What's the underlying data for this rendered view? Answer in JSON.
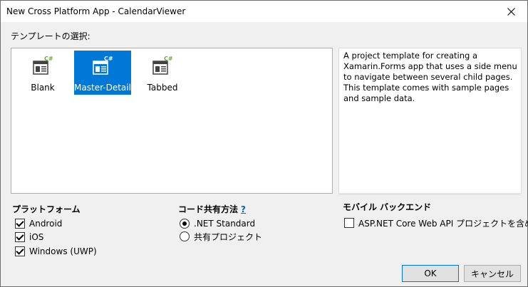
{
  "window": {
    "title": "New Cross Platform App - CalendarViewer"
  },
  "templates": {
    "heading": "テンプレートの選択:",
    "items": [
      {
        "label": "Blank",
        "icon": "csharp-template-icon",
        "selected": false
      },
      {
        "label": "Master-Detail",
        "icon": "csharp-template-icon",
        "selected": true
      },
      {
        "label": "Tabbed",
        "icon": "csharp-template-icon",
        "selected": false
      }
    ],
    "description": "A project template for creating a Xamarin.Forms app that uses a side menu to navigate between several child pages. This template comes with sample pages and sample data."
  },
  "platform": {
    "heading": "プラットフォーム",
    "options": [
      {
        "label": "Android",
        "checked": true
      },
      {
        "label": "iOS",
        "checked": true
      },
      {
        "label": "Windows (UWP)",
        "checked": true
      }
    ]
  },
  "code_sharing": {
    "heading": "コード共有方法",
    "help": "?",
    "options": [
      {
        "label": ".NET Standard",
        "selected": true
      },
      {
        "label": "共有プロジェクト",
        "selected": false
      }
    ]
  },
  "mobile_backend": {
    "heading": "モバイル バックエンド",
    "option": {
      "label": "ASP.NET Core Web API プロジェクトを含める",
      "checked": false
    }
  },
  "buttons": {
    "ok": "OK",
    "cancel": "キャンセル"
  },
  "colors": {
    "selection": "#0078d7",
    "link": "#0066cc",
    "csharp_badge": "#68a93a"
  }
}
